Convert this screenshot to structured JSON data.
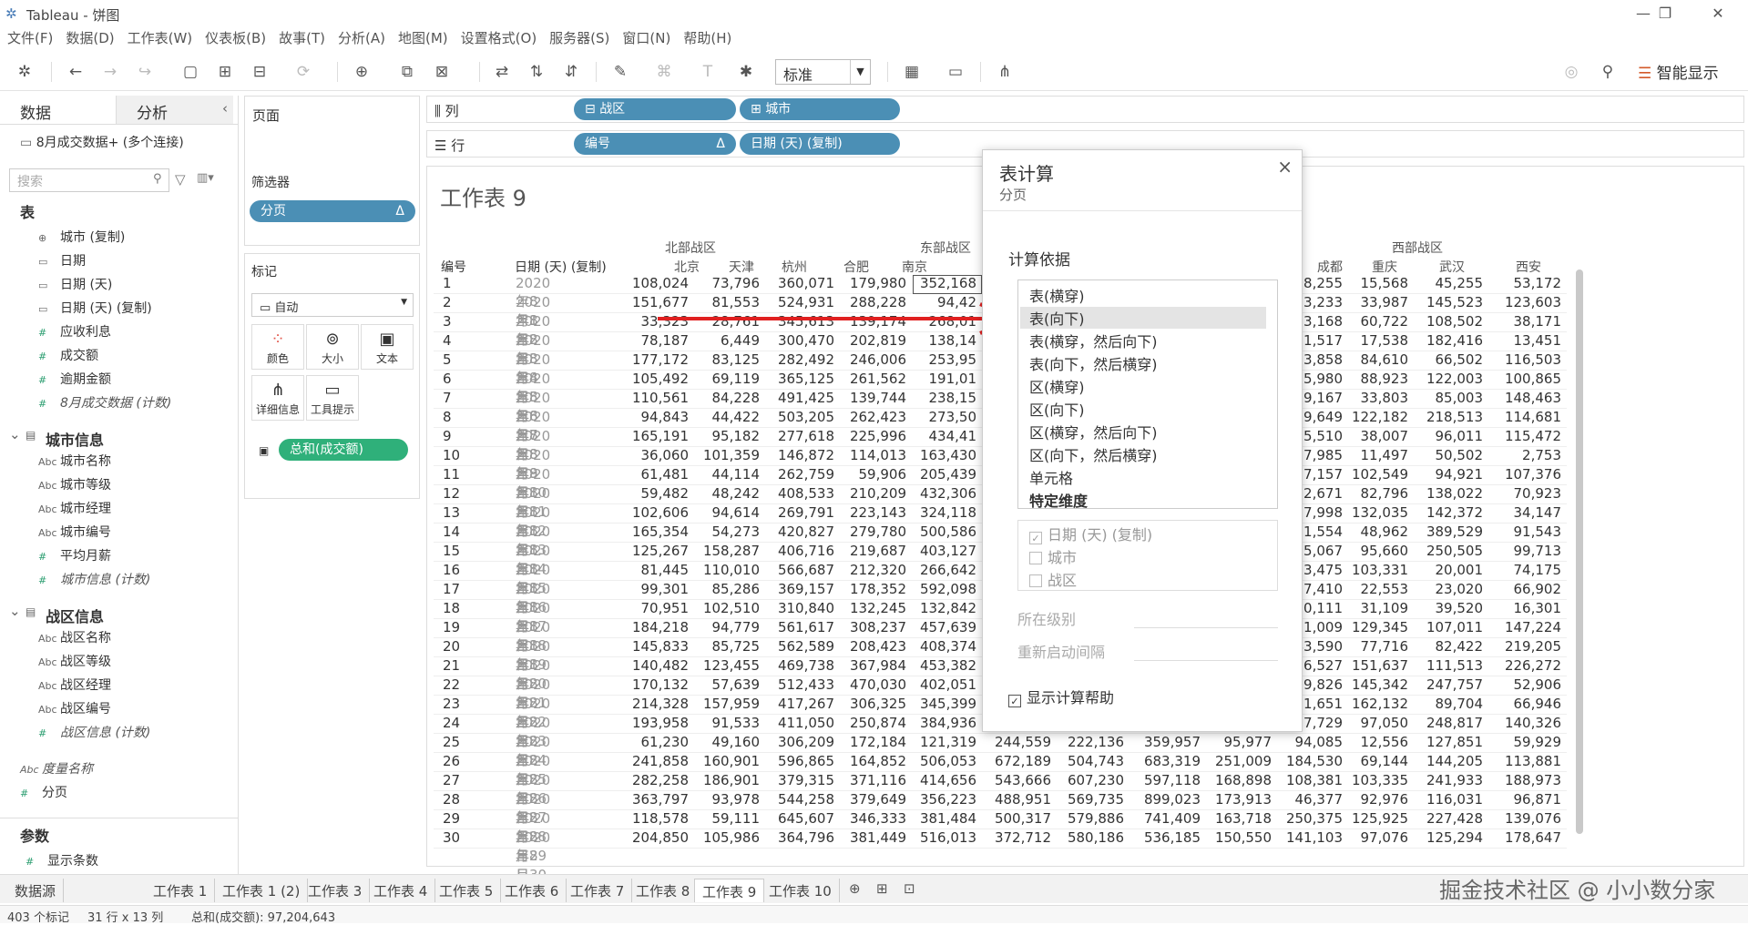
{
  "window": {
    "title": "Tableau - 饼图",
    "min": "—",
    "max": "❐",
    "close": "✕"
  },
  "menu": [
    "文件(F)",
    "数据(D)",
    "工作表(W)",
    "仪表板(B)",
    "故事(T)",
    "分析(A)",
    "地图(M)",
    "设置格式(O)",
    "服务器(S)",
    "窗口(N)",
    "帮助(H)"
  ],
  "toolbar": {
    "fit": "标准",
    "smart": "智能显示"
  },
  "left": {
    "tab_data": "数据",
    "tab_analysis": "分析",
    "connection": "8月成交数据+ (多个连接)",
    "search_placeholder": "搜索",
    "section_table": "表",
    "fields_table": [
      {
        "icon": "⊕",
        "name": "城市 (复制)"
      },
      {
        "icon": "▭",
        "name": "日期"
      },
      {
        "icon": "▭",
        "name": "日期 (天)"
      },
      {
        "icon": "▭",
        "name": "日期 (天) (复制)"
      },
      {
        "icon": "#",
        "name": "应收利息"
      },
      {
        "icon": "#",
        "name": "成交额"
      },
      {
        "icon": "#",
        "name": "逾期金额"
      },
      {
        "icon": "#",
        "name": "8月成交数据 (计数)"
      }
    ],
    "section_city": "城市信息",
    "fields_city": [
      {
        "icon": "Abc",
        "name": "城市名称"
      },
      {
        "icon": "Abc",
        "name": "城市等级"
      },
      {
        "icon": "Abc",
        "name": "城市经理"
      },
      {
        "icon": "Abc",
        "name": "城市编号"
      },
      {
        "icon": "#",
        "name": "平均月薪"
      },
      {
        "icon": "#",
        "name": "城市信息 (计数)"
      }
    ],
    "section_zone": "战区信息",
    "fields_zone": [
      {
        "icon": "Abc",
        "name": "战区名称"
      },
      {
        "icon": "Abc",
        "name": "战区等级"
      },
      {
        "icon": "Abc",
        "name": "战区经理"
      },
      {
        "icon": "Abc",
        "name": "战区编号"
      },
      {
        "icon": "#",
        "name": "战区信息 (计数)"
      }
    ],
    "field_measure_name": "度量名称",
    "field_paging": "分页",
    "section_params": "参数",
    "param_show_count": "显示条数"
  },
  "mid": {
    "pages": "页面",
    "filters": "筛选器",
    "filter_pill": "分页",
    "filter_delta": "Δ",
    "marks": "标记",
    "mark_type": "自动",
    "btn_color": "颜色",
    "btn_size": "大小",
    "btn_text": "文本",
    "btn_detail": "详细信息",
    "btn_tooltip": "工具提示",
    "sum_pill": "总和(成交额)"
  },
  "shelves": {
    "cols_label": "列",
    "rows_label": "行",
    "cols": [
      "战区",
      "城市"
    ],
    "rows": [
      "编号",
      "日期 (天) (复制)"
    ],
    "delta": "Δ"
  },
  "sheet": {
    "title": "工作表 9",
    "hdr_id": "编号",
    "hdr_date": "日期 (天) (复制)",
    "zones": [
      "北部战区",
      "东部战区",
      "西部战区"
    ],
    "cities_left": [
      "北京",
      "天津",
      "杭州",
      "合肥",
      "南京"
    ],
    "cities_right": [
      "成都",
      "重庆",
      "武汉",
      "西安"
    ],
    "rows": [
      {
        "n": "1",
        "d": "2020年8月1日",
        "v": [
          "108,024",
          "73,796",
          "360,071",
          "179,980",
          "352,168"
        ],
        "w": [
          "08,255",
          "15,568",
          "45,255",
          "53,172"
        ]
      },
      {
        "n": "2",
        "d": "2020年8月2日",
        "v": [
          "151,677",
          "81,553",
          "524,931",
          "288,228",
          "94,42"
        ],
        "w": [
          "3,233",
          "33,987",
          "145,523",
          "123,603"
        ]
      },
      {
        "n": "3",
        "d": "2020年8月3日",
        "v": [
          "33,323",
          "28,761",
          "345,613",
          "139,174",
          "268,01"
        ],
        "w": [
          "3,168",
          "60,722",
          "108,502",
          "38,171"
        ]
      },
      {
        "n": "4",
        "d": "2020年8月4日",
        "v": [
          "78,187",
          "6,449",
          "300,470",
          "202,819",
          "138,14"
        ],
        "w": [
          "1,517",
          "17,538",
          "182,416",
          "13,451"
        ]
      },
      {
        "n": "5",
        "d": "2020年8月5日",
        "v": [
          "177,172",
          "83,125",
          "282,492",
          "246,006",
          "253,95"
        ],
        "w": [
          "3,858",
          "84,610",
          "66,502",
          "116,503"
        ]
      },
      {
        "n": "6",
        "d": "2020年8月6日",
        "v": [
          "105,492",
          "69,119",
          "365,125",
          "261,562",
          "191,01"
        ],
        "w": [
          "5,980",
          "88,923",
          "122,003",
          "100,865"
        ]
      },
      {
        "n": "7",
        "d": "2020年8月7日",
        "v": [
          "110,561",
          "84,228",
          "491,425",
          "139,744",
          "238,15"
        ],
        "w": [
          "9,167",
          "33,803",
          "85,003",
          "148,463"
        ]
      },
      {
        "n": "8",
        "d": "2020年8月8日",
        "v": [
          "94,843",
          "44,422",
          "503,205",
          "262,423",
          "273,50"
        ],
        "w": [
          "9,649",
          "122,182",
          "218,513",
          "114,681"
        ]
      },
      {
        "n": "9",
        "d": "2020年8月9日",
        "v": [
          "165,191",
          "95,182",
          "277,618",
          "225,996",
          "434,41"
        ],
        "w": [
          "5,510",
          "38,007",
          "96,011",
          "115,472"
        ]
      },
      {
        "n": "10",
        "d": "2020年8月10日",
        "v": [
          "36,060",
          "101,359",
          "146,872",
          "114,013",
          "163,430"
        ],
        "w": [
          "37,985",
          "11,497",
          "50,502",
          "2,753"
        ]
      },
      {
        "n": "11",
        "d": "2020年8月11日",
        "v": [
          "61,481",
          "44,114",
          "262,759",
          "59,906",
          "205,439"
        ],
        "w": [
          "17,157",
          "102,549",
          "94,921",
          "107,376"
        ]
      },
      {
        "n": "12",
        "d": "2020年8月12日",
        "v": [
          "59,482",
          "48,242",
          "408,533",
          "210,209",
          "432,306"
        ],
        "w": [
          "02,671",
          "82,796",
          "138,022",
          "70,923"
        ]
      },
      {
        "n": "13",
        "d": "2020年8月13日",
        "v": [
          "102,606",
          "94,614",
          "269,791",
          "223,143",
          "324,118"
        ],
        "w": [
          "97,998",
          "132,035",
          "142,372",
          "34,147"
        ]
      },
      {
        "n": "14",
        "d": "2020年8月14日",
        "v": [
          "165,354",
          "54,273",
          "420,827",
          "279,780",
          "500,586"
        ],
        "w": [
          "91,554",
          "48,962",
          "389,529",
          "91,543"
        ]
      },
      {
        "n": "15",
        "d": "2020年8月15日",
        "v": [
          "125,267",
          "158,287",
          "406,716",
          "219,687",
          "403,127"
        ],
        "w": [
          "75,067",
          "95,660",
          "250,505",
          "99,713"
        ]
      },
      {
        "n": "16",
        "d": "2020年8月16日",
        "v": [
          "81,445",
          "110,010",
          "566,687",
          "212,320",
          "266,642"
        ],
        "w": [
          "03,475",
          "103,331",
          "20,001",
          "74,175"
        ]
      },
      {
        "n": "17",
        "d": "2020年8月17日",
        "v": [
          "99,301",
          "85,286",
          "369,157",
          "178,352",
          "592,098"
        ],
        "w": [
          "07,410",
          "22,553",
          "23,020",
          "66,902"
        ]
      },
      {
        "n": "18",
        "d": "2020年8月18日",
        "v": [
          "70,951",
          "102,510",
          "310,840",
          "132,245",
          "132,842"
        ],
        "w": [
          "10,111",
          "31,109",
          "39,520",
          "16,301"
        ]
      },
      {
        "n": "19",
        "d": "2020年8月19日",
        "v": [
          "184,218",
          "94,779",
          "561,617",
          "308,237",
          "457,639"
        ],
        "w": [
          "81,009",
          "129,345",
          "107,011",
          "147,224"
        ]
      },
      {
        "n": "20",
        "d": "2020年8月20日",
        "v": [
          "145,833",
          "85,725",
          "562,589",
          "208,423",
          "408,374"
        ],
        "w": [
          "43,590",
          "77,716",
          "82,422",
          "219,205"
        ]
      },
      {
        "n": "21",
        "d": "2020年8月21日",
        "v": [
          "140,482",
          "123,455",
          "469,738",
          "367,984",
          "453,382"
        ],
        "w": [
          "36,527",
          "151,637",
          "111,513",
          "226,272"
        ]
      },
      {
        "n": "22",
        "d": "2020年8月22日",
        "v": [
          "170,132",
          "57,639",
          "512,433",
          "470,030",
          "402,051"
        ],
        "w": [
          "09,826",
          "145,342",
          "247,757",
          "52,906"
        ]
      },
      {
        "n": "23",
        "d": "2020年8月23日",
        "v": [
          "214,328",
          "157,959",
          "417,267",
          "306,325",
          "345,399"
        ],
        "w": [
          "11,651",
          "162,132",
          "89,704",
          "66,946"
        ]
      },
      {
        "n": "24",
        "d": "2020年8月24日",
        "v": [
          "193,958",
          "91,533",
          "411,050",
          "250,874",
          "384,936"
        ],
        "w": [
          "57,729",
          "97,050",
          "248,817",
          "140,326"
        ]
      },
      {
        "n": "25",
        "d": "2020年8月25日",
        "v": [
          "61,230",
          "49,160",
          "306,209",
          "172,184",
          "121,319"
        ],
        "x": [
          "244,559",
          "222,136",
          "359,957",
          "95,977"
        ],
        "w": [
          "94,085",
          "12,556",
          "127,851",
          "59,929"
        ]
      },
      {
        "n": "26",
        "d": "2020年8月26日",
        "v": [
          "241,858",
          "160,901",
          "596,865",
          "164,852",
          "506,053"
        ],
        "x": [
          "672,189",
          "504,743",
          "683,319",
          "251,009"
        ],
        "w": [
          "184,530",
          "69,144",
          "144,205",
          "113,881"
        ]
      },
      {
        "n": "27",
        "d": "2020年8月27日",
        "v": [
          "282,258",
          "186,901",
          "379,315",
          "371,116",
          "414,656"
        ],
        "x": [
          "543,666",
          "607,230",
          "597,118",
          "168,898"
        ],
        "w": [
          "108,381",
          "103,335",
          "241,933",
          "188,973"
        ]
      },
      {
        "n": "28",
        "d": "2020年8月28日",
        "v": [
          "363,797",
          "93,978",
          "544,258",
          "379,649",
          "356,223"
        ],
        "x": [
          "488,951",
          "569,735",
          "899,023",
          "173,913"
        ],
        "w": [
          "46,377",
          "92,976",
          "116,031",
          "96,871"
        ]
      },
      {
        "n": "29",
        "d": "2020年8月29日",
        "v": [
          "118,578",
          "59,111",
          "645,607",
          "346,333",
          "381,484"
        ],
        "x": [
          "500,317",
          "579,886",
          "741,409",
          "163,718"
        ],
        "w": [
          "250,375",
          "125,925",
          "227,428",
          "139,076"
        ]
      },
      {
        "n": "30",
        "d": "2020年8月30日",
        "v": [
          "204,850",
          "105,986",
          "364,796",
          "381,449",
          "516,013"
        ],
        "x": [
          "372,712",
          "580,186",
          "536,185",
          "150,550"
        ],
        "w": [
          "141,103",
          "97,076",
          "125,294",
          "178,647"
        ]
      }
    ]
  },
  "dialog": {
    "title": "表计算",
    "subtitle": "分页",
    "close": "×",
    "calc_label": "计算依据",
    "options": [
      "表(横穿)",
      "表(向下)",
      "表(横穿，然后向下)",
      "表(向下，然后横穿)",
      "区(横穿)",
      "区(向下)",
      "区(横穿，然后向下)",
      "区(向下，然后横穿)",
      "单元格",
      "特定维度"
    ],
    "selected_index": 1,
    "dims": [
      {
        "label": "日期 (天) (复制)",
        "checked": true
      },
      {
        "label": "城市",
        "checked": false
      },
      {
        "label": "战区",
        "checked": false
      }
    ],
    "level_label": "所在级别",
    "restart_label": "重新启动间隔",
    "show_help": "显示计算帮助"
  },
  "sheettabs": [
    "数据源",
    "工作表 1",
    "工作表 1 (2)",
    "工作表 3",
    "工作表 4",
    "工作表 5",
    "工作表 6",
    "工作表 7",
    "工作表 8",
    "工作表 9",
    "工作表 10"
  ],
  "active_tab": "工作表 9",
  "status": {
    "marks": "403 个标记",
    "dims": "31 行 x 13 列",
    "sum": "总和(成交额): 97,204,643"
  },
  "watermark": "掘金技术社区 @ 小小数分家"
}
